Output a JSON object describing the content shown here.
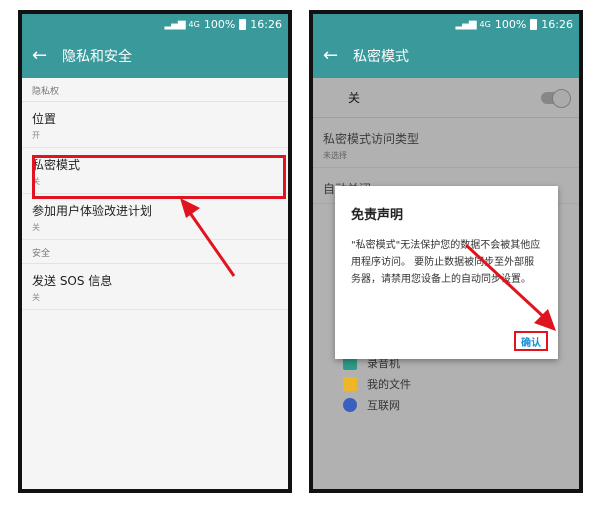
{
  "status": {
    "network": "4G",
    "battery": "100%",
    "time": "16:26"
  },
  "left": {
    "title": "隐私和安全",
    "section1": "隐私权",
    "items": [
      {
        "label": "位置",
        "sub": "开"
      },
      {
        "label": "私密模式",
        "sub": "关"
      },
      {
        "label": "参加用户体验改进计划",
        "sub": "关"
      }
    ],
    "section2": "安全",
    "items2": [
      {
        "label": "发送 SOS 信息",
        "sub": "关"
      }
    ]
  },
  "right": {
    "title": "私密模式",
    "switch_label": "关",
    "settings": [
      {
        "label": "私密模式访问类型",
        "sub": "未选择"
      },
      {
        "label": "自动关闭"
      }
    ],
    "dialog": {
      "title": "免责声明",
      "body": "\"私密模式\"无法保护您的数据不会被其他应用程序访问。 要防止数据被同步至外部服务器，请禁用您设备上的自动同步设置。",
      "confirm": "确认"
    },
    "apps": [
      {
        "label": "录音机",
        "icon": "recorder-icon",
        "color": "#2f9a86"
      },
      {
        "label": "我的文件",
        "icon": "folder-icon",
        "color": "#f0b62a"
      },
      {
        "label": "互联网",
        "icon": "globe-icon",
        "color": "#3b5fbf"
      }
    ]
  },
  "colors": {
    "teal": "#3a9a9b",
    "highlight": "#e0141e",
    "confirm_text": "#1b8fd2"
  }
}
